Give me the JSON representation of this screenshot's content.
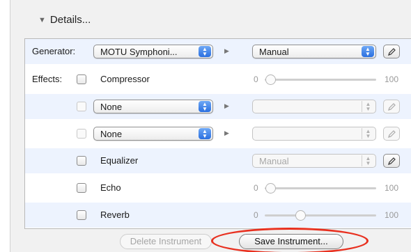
{
  "details": {
    "label": "Details...",
    "icon": "disclosure-triangle-down-icon"
  },
  "generator": {
    "label": "Generator:",
    "instrument": "MOTU Symphoni...",
    "mode": "Manual"
  },
  "effects": {
    "label": "Effects:",
    "compressor": {
      "label": "Compressor",
      "min": "0",
      "max": "100",
      "level": 0.0
    },
    "slot1": {
      "value": "None"
    },
    "slot2": {
      "value": "None"
    },
    "equalizer": {
      "label": "Equalizer",
      "mode": "Manual"
    },
    "echo": {
      "label": "Echo",
      "min": "0",
      "max": "100",
      "level": 0.0
    },
    "reverb": {
      "label": "Reverb",
      "min": "0",
      "max": "100",
      "level": 0.3
    }
  },
  "footer": {
    "delete_label": "Delete Instrument",
    "save_label": "Save Instrument..."
  },
  "colors": {
    "accent": "#2a6fe0",
    "row_alt": "#edf3fe",
    "highlight_ring": "#e8301f"
  }
}
